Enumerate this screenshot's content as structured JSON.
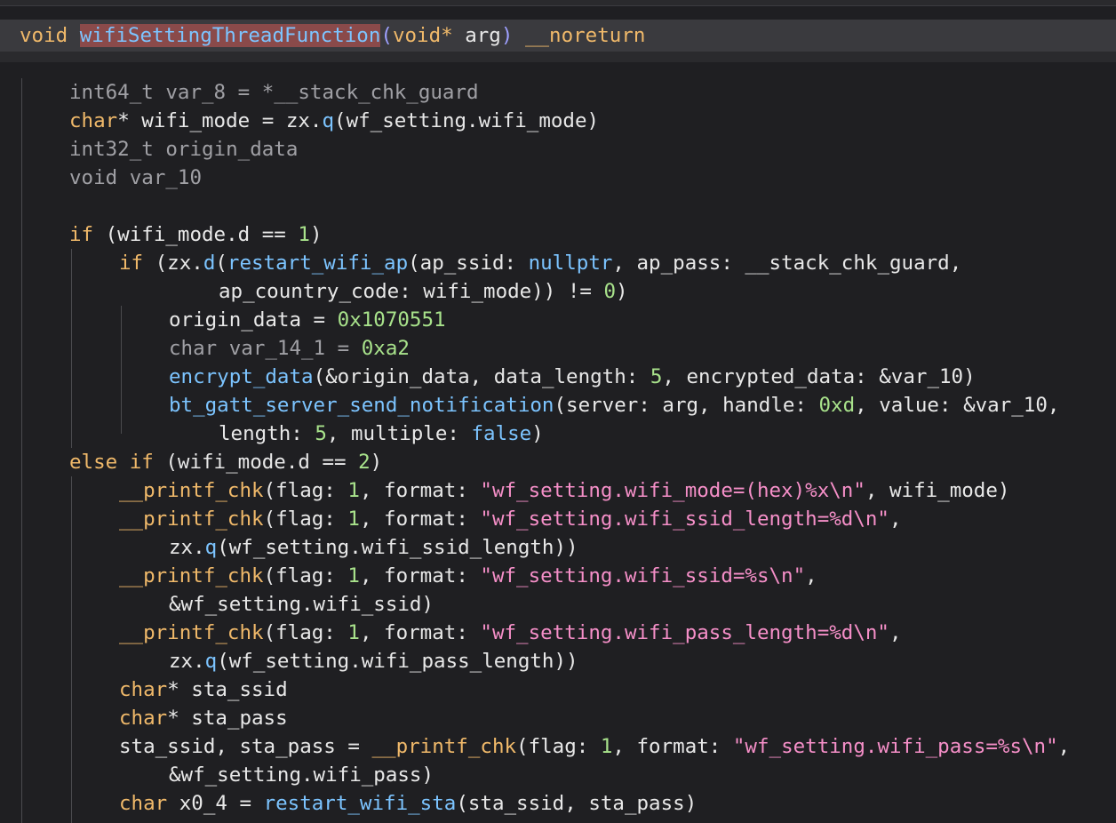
{
  "signature": {
    "ret_type": "void",
    "name": "wifiSettingThreadFunction",
    "param_type": "void*",
    "param_name": "arg",
    "attr": "__noreturn"
  },
  "lines": [
    "int64_t var_8 = *__stack_chk_guard",
    "char* wifi_mode = zx.q(wf_setting.wifi_mode)",
    "int32_t origin_data",
    "void var_10",
    "",
    "if (wifi_mode.d == 1)",
    "if (zx.d(restart_wifi_ap(ap_ssid: nullptr, ap_pass: __stack_chk_guard,",
    "ap_country_code: wifi_mode)) != 0)",
    "origin_data = 0x1070551",
    "char var_14_1 = 0xa2",
    "encrypt_data(&origin_data, data_length: 5, encrypted_data: &var_10)",
    "bt_gatt_server_send_notification(server: arg, handle: 0xd, value: &var_10,",
    "length: 5, multiple: false)",
    "else if (wifi_mode.d == 2)",
    "__printf_chk(flag: 1, format: \"wf_setting.wifi_mode=(hex)%x\\n\", wifi_mode)",
    "__printf_chk(flag: 1, format: \"wf_setting.wifi_ssid_length=%d\\n\",",
    "zx.q(wf_setting.wifi_ssid_length))",
    "__printf_chk(flag: 1, format: \"wf_setting.wifi_ssid=%s\\n\",",
    "&wf_setting.wifi_ssid)",
    "__printf_chk(flag: 1, format: \"wf_setting.wifi_pass_length=%d\\n\",",
    "zx.q(wf_setting.wifi_pass_length))",
    "char* sta_ssid",
    "char* sta_pass",
    "sta_ssid, sta_pass = __printf_chk(flag: 1, format: \"wf_setting.wifi_pass=%s\\n\",",
    "&wf_setting.wifi_pass)",
    "char x0_4 = restart_wifi_sta(sta_ssid, sta_pass)"
  ]
}
